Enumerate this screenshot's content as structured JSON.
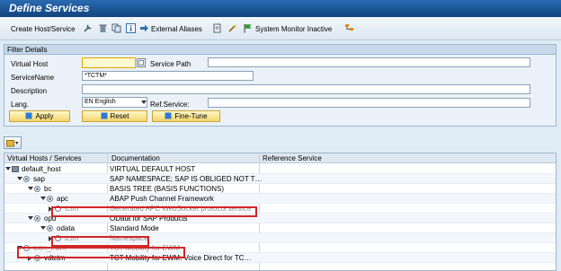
{
  "app": {
    "title": "Define Services"
  },
  "toolbar": {
    "create_label": "Create Host/Service",
    "external_aliases_label": "External Aliases",
    "system_monitor_label": "System Monitor Inactive",
    "icons": [
      "wrench-icon",
      "trash-icon",
      "copy-icon",
      "info-icon",
      "arrow-right-icon",
      "document-icon",
      "magic-wand-icon",
      "flag-icon",
      "hierarchy-icon"
    ]
  },
  "filter": {
    "header": "Filter Details",
    "virtual_host_label": "Virtual Host",
    "virtual_host_value": "",
    "service_path_label": "Service Path",
    "service_path_value": "",
    "service_name_label": "ServiceName",
    "service_name_value": "*TCTM*",
    "description_label": "Description",
    "description_value": "",
    "lang_label": "Lang.",
    "lang_value": "EN English",
    "ref_service_label": "Ref.Service:",
    "ref_service_value": "",
    "apply_label": "Apply",
    "reset_label": "Reset",
    "finetune_label": "Fine-Tune"
  },
  "tree": {
    "columns": [
      "Virtual Hosts / Services",
      "Documentation",
      "Reference Service"
    ],
    "rows": [
      {
        "name": "default_host",
        "doc": "VIRTUAL DEFAULT HOST",
        "level": 0,
        "expanded": true,
        "grey": false
      },
      {
        "name": "sap",
        "doc": "SAP NAMESPACE; SAP IS OBLIGED NOT T…",
        "level": 1,
        "expanded": true,
        "grey": false
      },
      {
        "name": "bc",
        "doc": "BASIS TREE (BASIS FUNCTIONS)",
        "level": 2,
        "expanded": true,
        "grey": false
      },
      {
        "name": "apc",
        "doc": "ABAP Push Channel Framework",
        "level": 3,
        "expanded": true,
        "grey": false
      },
      {
        "name": "tctm",
        "doc": "Generated APC WebSocket protocol service",
        "level": 4,
        "expanded": false,
        "grey": true
      },
      {
        "name": "opu",
        "doc": "OData for SAP Products",
        "level": 2,
        "expanded": true,
        "grey": false
      },
      {
        "name": "odata",
        "doc": "Standard Mode",
        "level": 3,
        "expanded": true,
        "grey": false
      },
      {
        "name": "tctm",
        "doc": "Namespace",
        "level": 4,
        "expanded": false,
        "grey": true
      },
      {
        "name": "tctm_ewm",
        "doc": "TCT Mobility for EWM",
        "level": 1,
        "expanded": true,
        "grey": true
      },
      {
        "name": "vdtctm",
        "doc": "TCT Mobility for EWM: Voice Direct for TC…",
        "level": 2,
        "expanded": false,
        "grey": false
      }
    ]
  },
  "colors": {
    "title_bar": "#1f5a9c",
    "highlight": "#d32626",
    "button": "#f5d56a",
    "background": "#dfebf5"
  }
}
